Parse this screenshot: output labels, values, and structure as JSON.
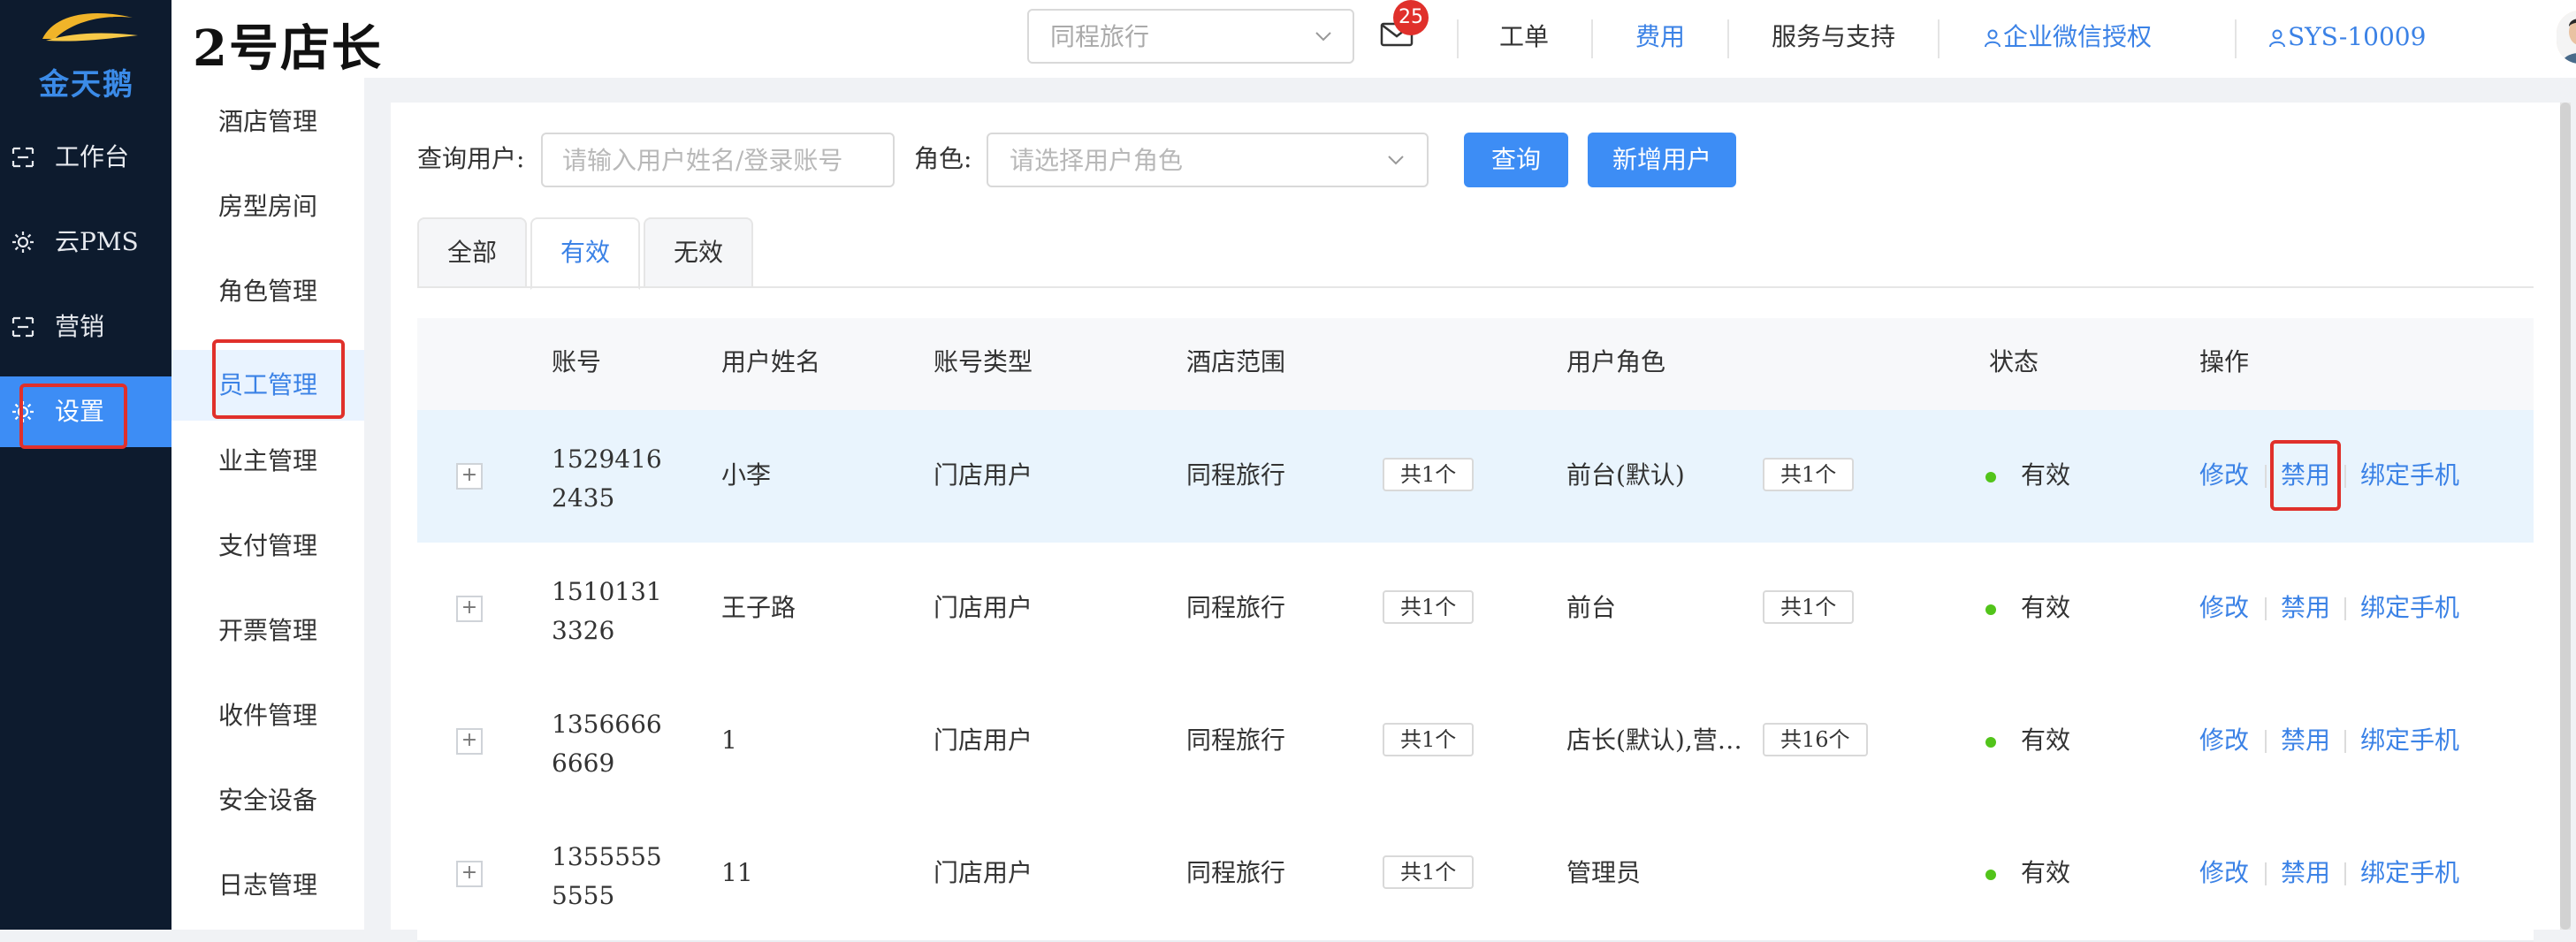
{
  "nav": {
    "logo_text": "金天鹅",
    "items": [
      {
        "label": "工作台",
        "icon": "dashboard-icon"
      },
      {
        "label": "云PMS",
        "icon": "gear-icon"
      },
      {
        "label": "营销",
        "icon": "marketing-icon"
      },
      {
        "label": "设置",
        "icon": "gear-icon",
        "active": true
      }
    ]
  },
  "header": {
    "brand": "2号店长",
    "hotel_select": "同程旅行",
    "mail_count": "25",
    "links": [
      "工单",
      "费用",
      "服务与支持",
      "企业微信授权",
      "SYS-10009"
    ]
  },
  "submenu": {
    "items": [
      "酒店管理",
      "房型房间",
      "角色管理",
      "员工管理",
      "业主管理",
      "支付管理",
      "开票管理",
      "收件管理",
      "安全设备",
      "日志管理"
    ],
    "active_index": 3
  },
  "filters": {
    "query_label": "查询用户:",
    "query_placeholder": "请输入用户姓名/登录账号",
    "role_label": "角色:",
    "role_placeholder": "请选择用户角色",
    "search_button": "查询",
    "add_button": "新增用户"
  },
  "tabs": [
    "全部",
    "有效",
    "无效"
  ],
  "active_tab": 1,
  "table": {
    "headers": [
      "账号",
      "用户姓名",
      "账号类型",
      "酒店范围",
      "用户角色",
      "状态",
      "操作"
    ],
    "rows": [
      {
        "account": "15294162435",
        "name": "小李",
        "type": "门店用户",
        "hotel": "同程旅行",
        "hotel_count": "共1个",
        "role": "前台(默认)",
        "role_count": "共1个",
        "status": "有效"
      },
      {
        "account": "15101313326",
        "name": "王子路",
        "type": "门店用户",
        "hotel": "同程旅行",
        "hotel_count": "共1个",
        "role": "前台",
        "role_count": "共1个",
        "status": "有效"
      },
      {
        "account": "13566666669",
        "name": "1",
        "type": "门店用户",
        "hotel": "同程旅行",
        "hotel_count": "共1个",
        "role": "店长(默认),营…",
        "role_count": "共16个",
        "status": "有效"
      },
      {
        "account": "13555555555",
        "name": "11",
        "type": "门店用户",
        "hotel": "同程旅行",
        "hotel_count": "共1个",
        "role": "管理员",
        "role_count": "",
        "status": "有效"
      }
    ],
    "actions": {
      "edit": "修改",
      "disable": "禁用",
      "bind": "绑定手机"
    }
  },
  "colors": {
    "accent": "#3d8df5",
    "sidebar": "#0d1b2e",
    "highlight": "#e0302b",
    "status_ok": "#52c41a"
  }
}
